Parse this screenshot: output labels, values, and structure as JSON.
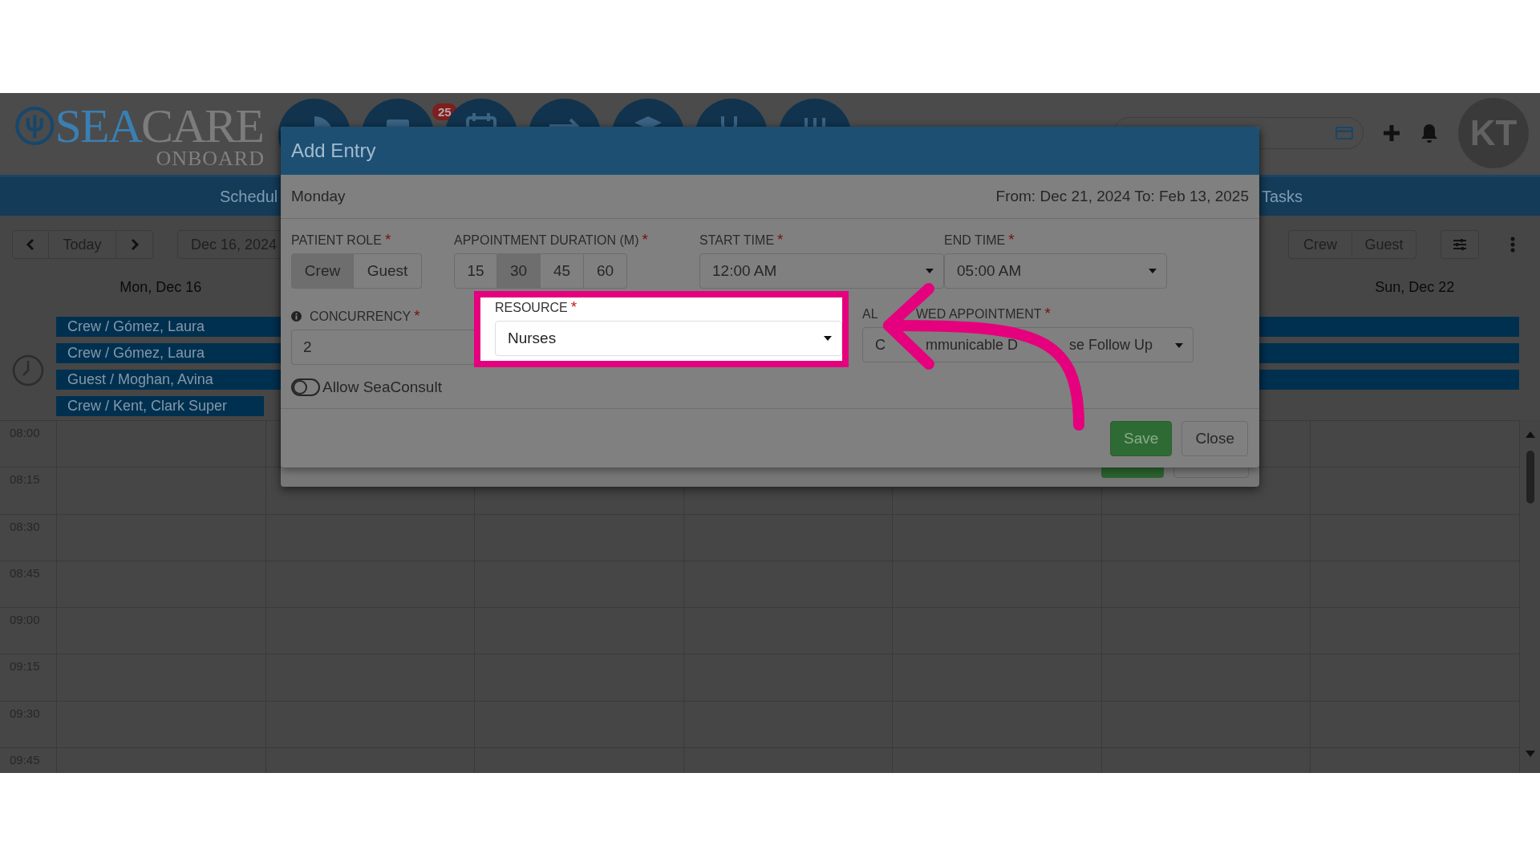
{
  "header": {
    "logo": {
      "primary": "SEA",
      "secondary": "CARE",
      "tagline": "ONBOARD"
    },
    "nav_badge": "25",
    "avatar": "KT"
  },
  "menu_bar": {
    "items": [
      {
        "label": "Schedul"
      },
      {
        "label": "Tasks"
      }
    ]
  },
  "toolbar": {
    "today": "Today",
    "date": "Dec 16, 2024",
    "role_filter": [
      {
        "label": "Crew",
        "selected": false
      },
      {
        "label": "Guest",
        "selected": false
      }
    ]
  },
  "calendar": {
    "days": [
      {
        "label": "Mon, Dec 16"
      },
      {
        "label": "Sun, Dec 22"
      }
    ],
    "events": [
      {
        "label": "Crew / Gómez, Laura",
        "kind": "week"
      },
      {
        "label": "Crew / Gómez, Laura",
        "kind": "week"
      },
      {
        "label": "Guest / Moghan, Avina",
        "kind": "week"
      },
      {
        "label": "Crew / Kent, Clark Super",
        "kind": "day"
      }
    ],
    "times": [
      "08:00",
      "08:15",
      "08:30",
      "08:45",
      "09:00",
      "09:15",
      "09:30",
      "09:45"
    ]
  },
  "dialog": {
    "title": "Add Entry",
    "day": "Monday",
    "range": "From: Dec 21, 2024 To: Feb 13, 2025",
    "patient_role": {
      "label": "PATIENT ROLE",
      "required_mark": "*",
      "options": [
        {
          "label": "Crew",
          "selected": true
        },
        {
          "label": "Guest",
          "selected": false
        }
      ]
    },
    "duration": {
      "label": "APPOINTMENT DURATION (M)",
      "required_mark": "*",
      "options": [
        {
          "label": "15",
          "selected": false
        },
        {
          "label": "30",
          "selected": true
        },
        {
          "label": "45",
          "selected": false
        },
        {
          "label": "60",
          "selected": false
        }
      ]
    },
    "start_time": {
      "label": "START TIME",
      "required_mark": "*",
      "value": "12:00 AM"
    },
    "end_time": {
      "label": "END TIME",
      "required_mark": "*",
      "value": "05:00 AM"
    },
    "concurrency": {
      "label": "CONCURRENCY",
      "required_mark": "*",
      "value": "2"
    },
    "resource": {
      "label": "RESOURCE",
      "required_mark": "*",
      "value": "Nurses",
      "highlighted": true
    },
    "allowed_appointment": {
      "label_parts": [
        "AL",
        "WED APPOINTMENT"
      ],
      "required_mark": "*",
      "value_parts": [
        "C",
        "mmunicable D",
        "se Follow Up"
      ]
    },
    "allow_seaconsult": {
      "label": "Allow SeaConsult",
      "on": false
    },
    "buttons": [
      {
        "label": "Save",
        "kind": "primary"
      },
      {
        "label": "Close",
        "kind": "default"
      }
    ]
  }
}
